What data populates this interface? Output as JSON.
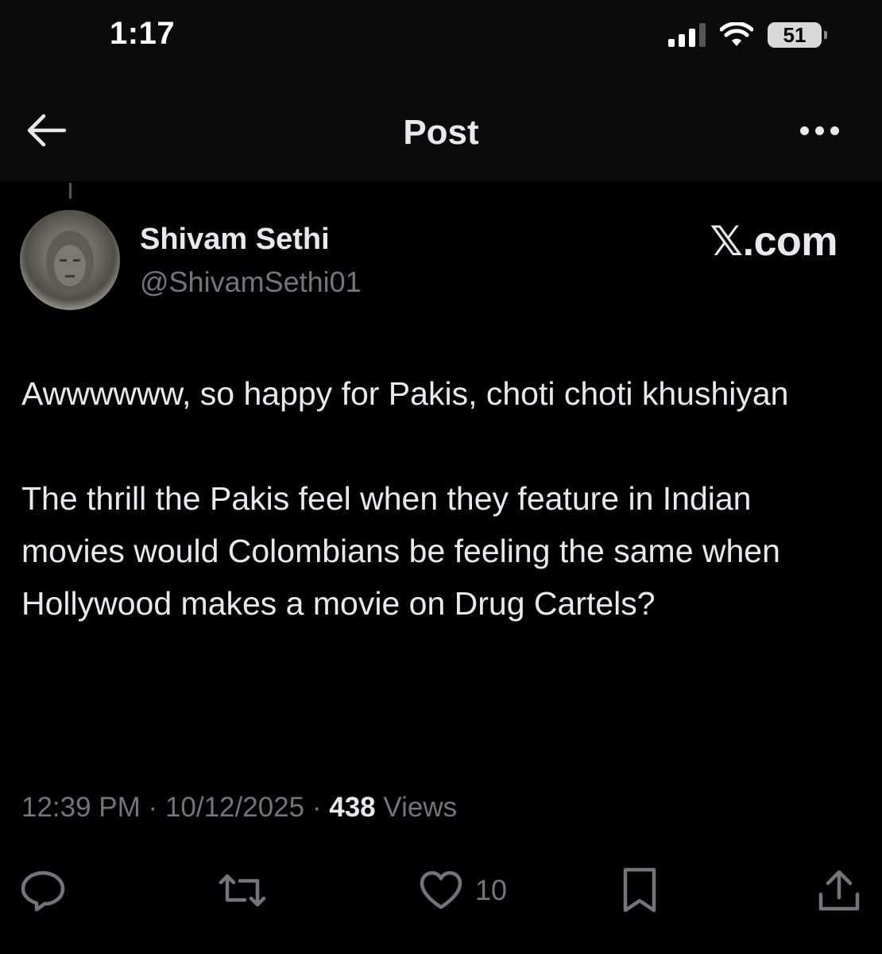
{
  "status_bar": {
    "time": "1:17",
    "battery": "51",
    "icons": [
      "signal-icon",
      "wifi-icon",
      "battery-icon"
    ]
  },
  "header": {
    "title": "Post",
    "back_icon": "arrow-left-icon",
    "more_icon": "more-horizontal-icon"
  },
  "post": {
    "author_name": "Shivam Sethi",
    "author_handle": "@ShivamSethi01",
    "watermark": "𝕏.com",
    "paragraphs": [
      "Awwwwww, so happy for Pakis, choti choti khushiyan",
      "The thrill the Pakis feel when they feature in Indian movies would Colombians be feeling the same when Hollywood makes a movie on Drug Cartels?"
    ],
    "time": "12:39 PM",
    "separator": "·",
    "date": "10/12/2025",
    "views_count": "438",
    "views_label": "Views"
  },
  "actions": {
    "reply_icon": "reply-icon",
    "repost_icon": "repost-icon",
    "like_icon": "heart-icon",
    "like_count": "10",
    "bookmark_icon": "bookmark-icon",
    "share_icon": "share-icon"
  },
  "colors": {
    "background": "#000000",
    "text": "#e7e9ea",
    "secondary": "#71767b"
  }
}
